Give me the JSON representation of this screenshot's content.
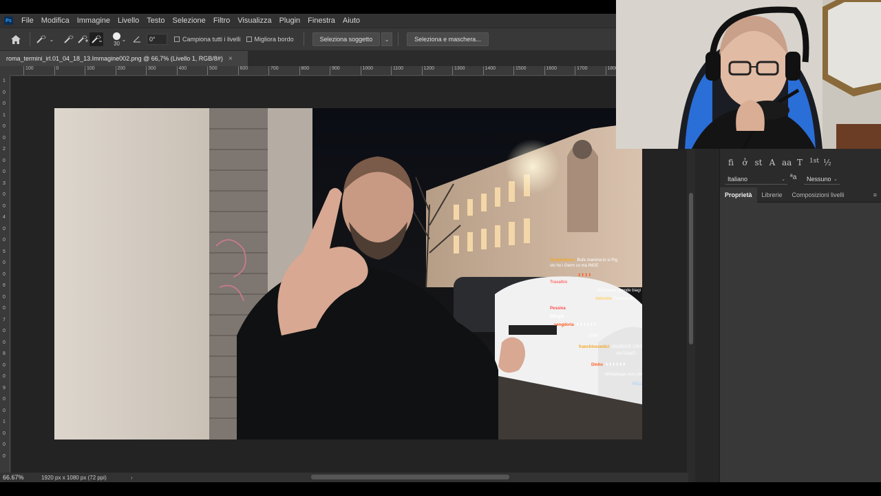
{
  "menu": {
    "logo": "Ps",
    "items": [
      "File",
      "Modifica",
      "Immagine",
      "Livello",
      "Testo",
      "Selezione",
      "Filtro",
      "Visualizza",
      "Plugin",
      "Finestra",
      "Aiuto"
    ]
  },
  "options": {
    "brush_size": "30",
    "angle": "0°",
    "sample_all_layers": "Campiona tutti i livelli",
    "enhance_edge": "Migliora bordo",
    "select_subject": "Seleziona soggetto",
    "select_and_mask": "Seleziona e maschera..."
  },
  "document": {
    "tab_title": "roma_termini_irl.01_04_18_13.Immagine002.png @ 66,7% (Livello 1, RGB/8#)",
    "close": "×"
  },
  "ruler": {
    "top": [
      "100",
      "0",
      "100",
      "200",
      "300",
      "400",
      "500",
      "600",
      "700",
      "800",
      "900",
      "1000",
      "1100",
      "1200",
      "1300",
      "1400",
      "1500",
      "1600",
      "1700",
      "1800"
    ],
    "left": [
      "1",
      "0",
      "0",
      "1",
      "0",
      "0",
      "2",
      "0",
      "0",
      "3",
      "0",
      "0",
      "4",
      "0",
      "0",
      "5",
      "0",
      "0",
      "6",
      "0",
      "0",
      "7",
      "0",
      "0",
      "8",
      "0",
      "0",
      "9",
      "0",
      "0",
      "1",
      "0",
      "0",
      "0"
    ]
  },
  "status": {
    "zoom": "66.67%",
    "doc_info": "1920 px x 1080 px (72 ppi)",
    "arrow": "›"
  },
  "chat": [
    {
      "name": "Tempodesco",
      "msg": "Bufe mamma lo si Pig",
      "color": "#f5a623"
    },
    {
      "name": "",
      "msg": "sto ho i Germ co ma INGE",
      "color": "#ffffff"
    },
    {
      "name": "",
      "msg": "⬆⬆⬆⬆",
      "color": "#ff5a1f"
    },
    {
      "name": "Trasaltro",
      "msg": "",
      "color": "#ff6b6b"
    },
    {
      "name": "",
      "msg": "Vittoreenar grande biagi",
      "color": "#ffffff"
    },
    {
      "name": "zielcone",
      "msg": "Fiocomodo",
      "color": "#ffd166"
    },
    {
      "name": "Pessina",
      "msg": "",
      "color": "#ff4d4d"
    },
    {
      "name": "liBirgin",
      "msg": "",
      "color": "#ffffff"
    },
    {
      "name": "vengdoria",
      "msg": "⬆⬆⬆⬆⬆⬆",
      "color": "#ff5a1f"
    },
    {
      "name": "",
      "msg": "2008",
      "color": "#ffffff"
    },
    {
      "name": "franchinosedici",
      "msg": "ONORATE CRISTO E GLI",
      "color": "#f5a623"
    },
    {
      "name": "",
      "msg": "ANTENATI",
      "color": "#ffffff"
    },
    {
      "name": "Dinho",
      "msg": "⬆⬆⬆⬆⬆⬆",
      "color": "#ff5a1f"
    },
    {
      "name": "",
      "msg": "Whitabyayo Ave Liberta Bos",
      "color": "#ffffff"
    },
    {
      "name": "",
      "msg": "RELLA BIAGI",
      "color": "#9ad0ff"
    }
  ],
  "panel": {
    "typography_glyphs": [
      "fi",
      "ở",
      "st",
      "A",
      "aa",
      "T",
      "1st",
      "½"
    ],
    "language": "Italiano",
    "aa_label": "ªa",
    "aa_value": "Nessuno",
    "tabs": [
      "Proprietà",
      "Librerie",
      "Composizioni livelli"
    ],
    "active_tab": "Proprietà",
    "menu_icon": "≡"
  },
  "icons": {
    "home": "home-icon",
    "brush": "quick-selection-icon",
    "chevron": "chevron-down-icon"
  },
  "colors": {
    "ps_blue": "#31a8ff",
    "panel_bg": "#383838",
    "app_bg": "#2b2b2b"
  }
}
